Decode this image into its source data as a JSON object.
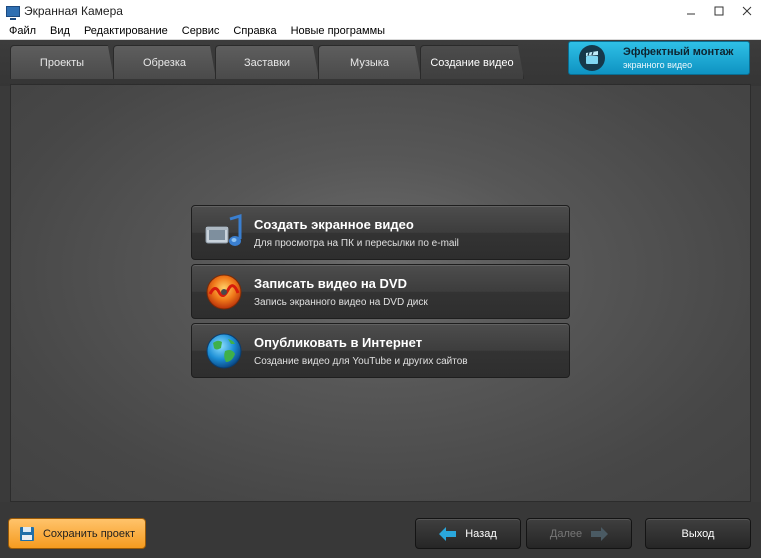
{
  "window": {
    "title": "Экранная Камера"
  },
  "menu": [
    "Файл",
    "Вид",
    "Редактирование",
    "Сервис",
    "Справка",
    "Новые программы"
  ],
  "tabs": [
    {
      "label": "Проекты"
    },
    {
      "label": "Обрезка"
    },
    {
      "label": "Заставки"
    },
    {
      "label": "Музыка"
    },
    {
      "label": "Создание видео",
      "active": true
    }
  ],
  "promo": {
    "title": "Эффектный монтаж",
    "subtitle": "экранного видео"
  },
  "options": [
    {
      "title": "Создать экранное видео",
      "subtitle": "Для просмотра на ПК и пересылки по e-mail",
      "icon": "film-music-icon"
    },
    {
      "title": "Записать видео на DVD",
      "subtitle": "Запись экранного видео на DVD диск",
      "icon": "dvd-disc-icon"
    },
    {
      "title": "Опубликовать в Интернет",
      "subtitle": "Создание видео для YouTube и других сайтов",
      "icon": "globe-icon"
    }
  ],
  "footer": {
    "save": "Сохранить проект",
    "back": "Назад",
    "next": "Далее",
    "exit": "Выход"
  },
  "colors": {
    "accent": "#1fb1dc",
    "save_button": "#f7a734"
  }
}
